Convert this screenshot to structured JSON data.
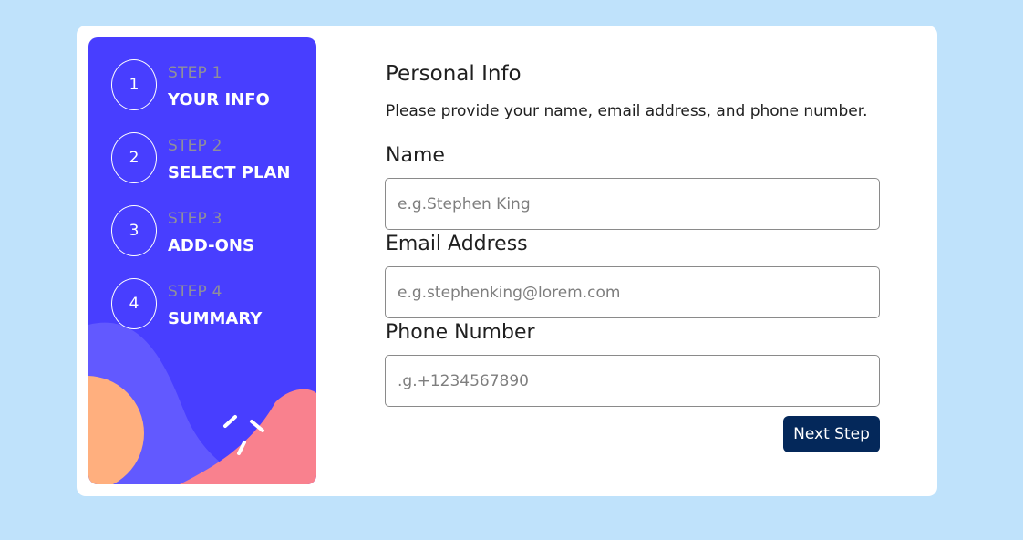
{
  "sidebar": {
    "steps": [
      {
        "number": "1",
        "label": "STEP 1",
        "title": "YOUR INFO"
      },
      {
        "number": "2",
        "label": "STEP 2",
        "title": "SELECT PLAN"
      },
      {
        "number": "3",
        "label": "STEP 3",
        "title": "ADD-ONS"
      },
      {
        "number": "4",
        "label": "STEP 4",
        "title": "SUMMARY"
      }
    ]
  },
  "form": {
    "title": "Personal Info",
    "subtitle": "Please provide your name, email address, and phone number.",
    "name_label": "Name",
    "name_placeholder": "e.g.Stephen King",
    "email_label": "Email Address",
    "email_placeholder": "e.g.stephenking@lorem.com",
    "phone_label": "Phone Number",
    "phone_placeholder": ".g.+1234567890",
    "next_label": "Next Step"
  },
  "colors": {
    "page_background": "#bfe2fb",
    "sidebar_background": "#483eff",
    "button_background": "#04285a",
    "decor_purple": "#6259ff",
    "decor_orange": "#ffaf7e",
    "decor_pink": "#f9818e"
  }
}
